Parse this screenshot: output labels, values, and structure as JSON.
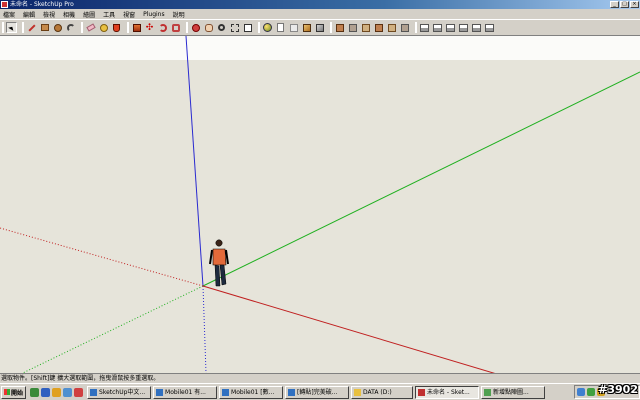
{
  "window": {
    "title": "未命名 - SketchUp Pro"
  },
  "menu": {
    "items": [
      "檔案",
      "編輯",
      "檢視",
      "相機",
      "繪圖",
      "工具",
      "視窗",
      "Plugins",
      "說明"
    ]
  },
  "status": {
    "text": "選取物件。[Shift]鍵 擴大選取範圍，拖曳滑鼠按多重選取。"
  },
  "taskbar": {
    "start_label": "開始",
    "tasks": [
      "SketchUp中文...",
      "Mobile01 有...",
      "Mobile01 [數...",
      "[轉貼]完美破...",
      "DATA (D:)",
      "未命名 - Sket...",
      "新增點陣圖..."
    ],
    "active_index": 5
  },
  "watermark": "#3902",
  "colors": {
    "axis_blue": "#2a2ad0",
    "axis_green": "#20b020",
    "axis_red": "#c02020",
    "ground": "#e6e4da",
    "sky": "#fbfbf9"
  }
}
